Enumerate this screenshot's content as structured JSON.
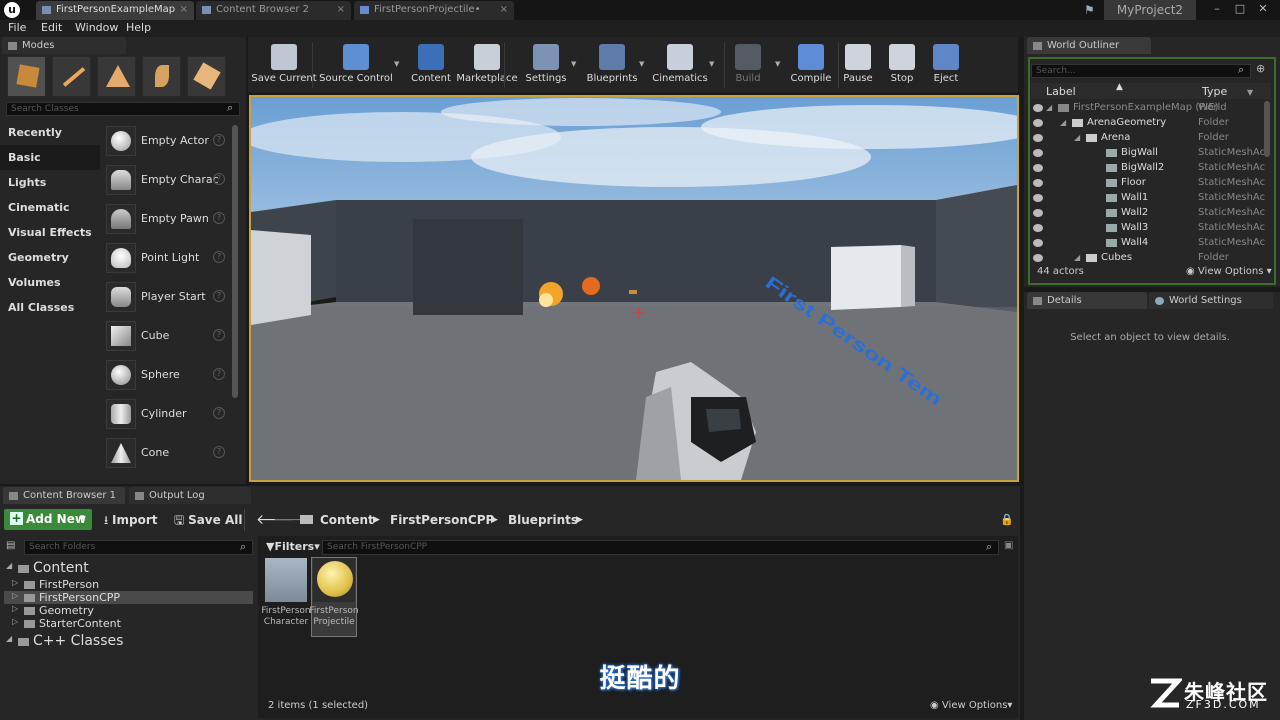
{
  "titlebar": {
    "tabs": [
      "FirstPersonExampleMap",
      "Content Browser 2",
      "FirstPersonProjectile•"
    ],
    "project": "MyProject2"
  },
  "menu": [
    "File",
    "Edit",
    "Window",
    "Help"
  ],
  "modes": {
    "tab": "Modes",
    "search_placeholder": "Search Classes",
    "categories": [
      "Recently Placed",
      "Basic",
      "Lights",
      "Cinematic",
      "Visual Effects",
      "Geometry",
      "Volumes",
      "All Classes"
    ],
    "selected_category": "Basic",
    "items": [
      "Empty Actor",
      "Empty Charac",
      "Empty Pawn",
      "Point Light",
      "Player Start",
      "Cube",
      "Sphere",
      "Cylinder",
      "Cone"
    ]
  },
  "toolbar": [
    "Save Current",
    "Source Control",
    "Content",
    "Marketplace",
    "Settings",
    "Blueprints",
    "Cinematics",
    "Build",
    "Compile",
    "Pause",
    "Stop",
    "Eject"
  ],
  "outliner": {
    "tab": "World Outliner",
    "search_placeholder": "Search...",
    "col_label": "Label",
    "col_type": "Type",
    "rows": [
      {
        "name": "FirstPersonExampleMap (PIE)",
        "type": "World"
      },
      {
        "name": "ArenaGeometry",
        "type": "Folder"
      },
      {
        "name": "Arena",
        "type": "Folder"
      },
      {
        "name": "BigWall",
        "type": "StaticMeshAc"
      },
      {
        "name": "BigWall2",
        "type": "StaticMeshAc"
      },
      {
        "name": "Floor",
        "type": "StaticMeshAc"
      },
      {
        "name": "Wall1",
        "type": "StaticMeshAc"
      },
      {
        "name": "Wall2",
        "type": "StaticMeshAc"
      },
      {
        "name": "Wall3",
        "type": "StaticMeshAc"
      },
      {
        "name": "Wall4",
        "type": "StaticMeshAc"
      },
      {
        "name": "Cubes",
        "type": "Folder"
      }
    ],
    "count": "44 actors",
    "view_options": "View Options"
  },
  "details": {
    "tab": "Details",
    "tab2": "World Settings",
    "empty": "Select an object to view details."
  },
  "content_browser": {
    "tab": "Content Browser 1",
    "tab2": "Output Log",
    "add_new": "Add New",
    "import": "Import",
    "save_all": "Save All",
    "path": [
      "Content",
      "FirstPersonCPP",
      "Blueprints"
    ],
    "folder_search": "Search Folders",
    "filters": "Filters",
    "asset_search": "Search FirstPersonCPP",
    "tree": [
      "Content",
      "FirstPerson",
      "FirstPersonCPP",
      "Geometry",
      "StarterContent",
      "C++ Classes"
    ],
    "assets": [
      {
        "label": "FirstPerson Character"
      },
      {
        "label": "FirstPerson Projectile"
      }
    ],
    "status": "2 items (1 selected)",
    "view_options": "View Options"
  },
  "viewport": {
    "floor_text": "First Person Tem"
  },
  "subtitle": "挺酷的",
  "watermark": {
    "brand": "朱峰社区",
    "url": "ZF3D.COM"
  }
}
